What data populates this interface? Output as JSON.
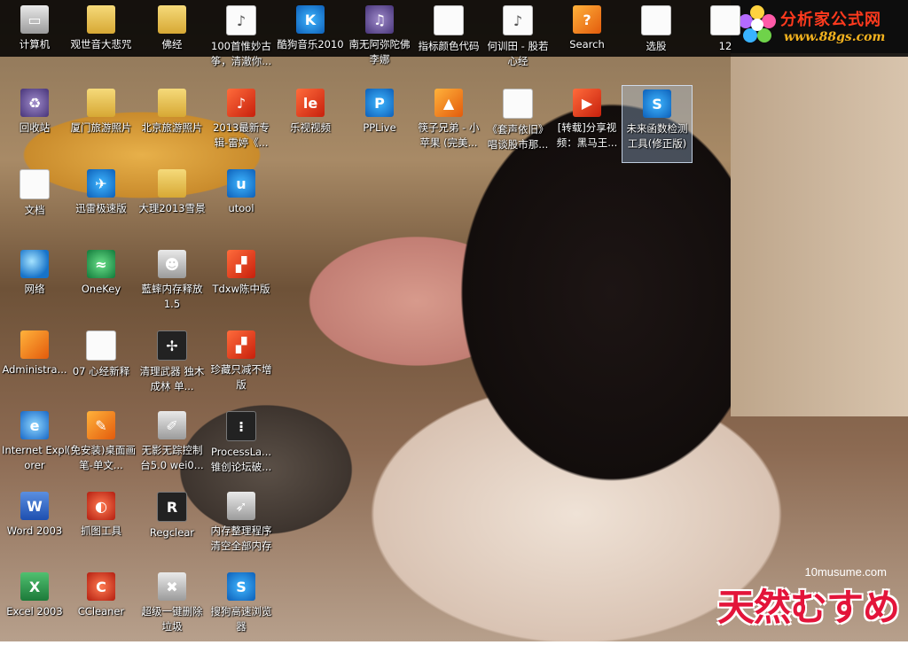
{
  "desktop": {
    "icons": [
      {
        "id": "computer",
        "label": "计算机",
        "glyph": "computer-icon",
        "style": "gray",
        "mark": "▭"
      },
      {
        "id": "guanshiyin",
        "label": "观世音大悲咒",
        "glyph": "folder-icon",
        "style": "folder",
        "mark": ""
      },
      {
        "id": "fojing",
        "label": "佛经",
        "glyph": "folder-icon",
        "style": "folder",
        "mark": ""
      },
      {
        "id": "100shou",
        "label": "100首惟妙古筝，清澈你...",
        "glyph": "audio-file-icon",
        "style": "doc",
        "mark": "♪"
      },
      {
        "id": "kugou",
        "label": "酷狗音乐2010",
        "glyph": "kugou-icon",
        "style": "blue",
        "mark": "K"
      },
      {
        "id": "namo",
        "label": "南无阿弥陀佛李娜",
        "glyph": "media-file-icon",
        "style": "purple",
        "mark": "♫"
      },
      {
        "id": "zhibiao",
        "label": "指标颜色代码",
        "glyph": "text-file-icon",
        "style": "doc",
        "mark": ""
      },
      {
        "id": "hexun",
        "label": "何训田 - 股若心经",
        "glyph": "mp3-file-icon",
        "style": "doc",
        "mark": "♪"
      },
      {
        "id": "search",
        "label": "Search",
        "glyph": "search-app-icon",
        "style": "orange",
        "mark": "?"
      },
      {
        "id": "xuangu",
        "label": "选股",
        "glyph": "text-file-icon",
        "style": "doc",
        "mark": ""
      },
      {
        "id": "12",
        "label": "12",
        "glyph": "text-file-icon",
        "style": "doc",
        "mark": ""
      },
      {
        "id": "recycle",
        "label": "回收站",
        "glyph": "recycle-bin-icon",
        "style": "purple",
        "mark": "♻"
      },
      {
        "id": "xiamen",
        "label": "厦门旅游照片",
        "glyph": "folder-icon",
        "style": "folder",
        "mark": ""
      },
      {
        "id": "beijing",
        "label": "北京旅游照片",
        "glyph": "folder-icon",
        "style": "folder",
        "mark": ""
      },
      {
        "id": "2013zhuanji",
        "label": "2013最新专辑-雷婷《...",
        "glyph": "audio-file-icon",
        "style": "red",
        "mark": "♪"
      },
      {
        "id": "leshi",
        "label": "乐视视频",
        "glyph": "letv-icon",
        "style": "red",
        "mark": "le"
      },
      {
        "id": "pplive",
        "label": "PPLive",
        "glyph": "pplive-icon",
        "style": "blue",
        "mark": "P"
      },
      {
        "id": "kuaizi",
        "label": "筷子兄弟 - 小苹果 (完美...",
        "glyph": "vlc-icon",
        "style": "orange",
        "mark": "▲"
      },
      {
        "id": "taosheng",
        "label": "《套声依旧》唱谈股市那...",
        "glyph": "text-file-icon",
        "style": "doc",
        "mark": ""
      },
      {
        "id": "zhuanzai",
        "label": "[转载]分享视频：黑马王...",
        "glyph": "video-file-icon",
        "style": "red",
        "mark": "▶"
      },
      {
        "id": "weilai",
        "label": "未来函数检测工具(修正版)",
        "glyph": "tool-icon",
        "style": "blue",
        "mark": "S"
      },
      {
        "id": "wendang",
        "label": "文档",
        "glyph": "documents-icon",
        "style": "doc",
        "mark": ""
      },
      {
        "id": "xunlei",
        "label": "迅雷极速版",
        "glyph": "xunlei-icon",
        "style": "blue",
        "mark": "✈"
      },
      {
        "id": "dali",
        "label": "大理2013雪景",
        "glyph": "folder-icon",
        "style": "folder",
        "mark": ""
      },
      {
        "id": "utool",
        "label": "utool",
        "glyph": "utool-icon",
        "style": "blue",
        "mark": "u"
      },
      {
        "id": "wangluo",
        "label": "网络",
        "glyph": "network-icon",
        "style": "globe",
        "mark": ""
      },
      {
        "id": "onekey",
        "label": "OneKey",
        "glyph": "onekey-icon",
        "style": "green",
        "mark": "≈"
      },
      {
        "id": "lanshi",
        "label": "藍蟀内存释放1.5",
        "glyph": "robot-icon",
        "style": "gray",
        "mark": "☻"
      },
      {
        "id": "tdxw",
        "label": "Tdxw陈中版",
        "glyph": "tdx-icon",
        "style": "red",
        "mark": "▞"
      },
      {
        "id": "admin",
        "label": "Administra...",
        "glyph": "user-folder-icon",
        "style": "orange",
        "mark": ""
      },
      {
        "id": "07xinjing",
        "label": "07 心经新释",
        "glyph": "text-file-icon",
        "style": "doc",
        "mark": ""
      },
      {
        "id": "qingli",
        "label": "清理武器 独木成林 单...",
        "glyph": "cleaner-icon",
        "style": "dark",
        "mark": "✢"
      },
      {
        "id": "zhencang",
        "label": "珍藏只减不增版",
        "glyph": "tdx-icon",
        "style": "red",
        "mark": "▞"
      },
      {
        "id": "ie",
        "label": "Internet Explorer",
        "glyph": "ie-icon",
        "style": "ie",
        "mark": "e"
      },
      {
        "id": "mianan",
        "label": "(免安装)桌面画笔-单文...",
        "glyph": "paint-icon",
        "style": "orange",
        "mark": "✎"
      },
      {
        "id": "wuying",
        "label": "无影无踪控制台5.0 wei0...",
        "glyph": "pen-icon",
        "style": "gray",
        "mark": "✐"
      },
      {
        "id": "processla",
        "label": "ProcessLa... 锥创论坛破...",
        "glyph": "traffic-light-icon",
        "style": "dark",
        "mark": "⁝"
      },
      {
        "id": "word",
        "label": "Word 2003",
        "glyph": "word-icon",
        "style": "word",
        "mark": "W"
      },
      {
        "id": "zhuatu",
        "label": "抓图工具",
        "glyph": "capture-icon",
        "style": "ccl",
        "mark": "◐"
      },
      {
        "id": "regclear",
        "label": "Regclear",
        "glyph": "regclear-icon",
        "style": "dark",
        "mark": "R"
      },
      {
        "id": "neicun",
        "label": "内存整理程序 清空全部内存",
        "glyph": "rocket-icon",
        "style": "gray",
        "mark": "➶"
      },
      {
        "id": "excel",
        "label": "Excel 2003",
        "glyph": "excel-icon",
        "style": "excel",
        "mark": "X"
      },
      {
        "id": "ccleaner",
        "label": "CCleaner",
        "glyph": "ccleaner-icon",
        "style": "ccl",
        "mark": "C"
      },
      {
        "id": "chaoji",
        "label": "超级一键删除垃圾",
        "glyph": "trash-tool-icon",
        "style": "gray",
        "mark": "✖"
      },
      {
        "id": "sougou",
        "label": "搜狗高速浏览器",
        "glyph": "sogou-browser-icon",
        "style": "blue",
        "mark": "S"
      }
    ],
    "selected_icon": "weilai"
  },
  "branding": {
    "top_logo_title": "分析家公式网",
    "top_logo_url": "www.88gs.com",
    "watermark_url": "10musume.com",
    "watermark_text": "天然むすめ"
  }
}
